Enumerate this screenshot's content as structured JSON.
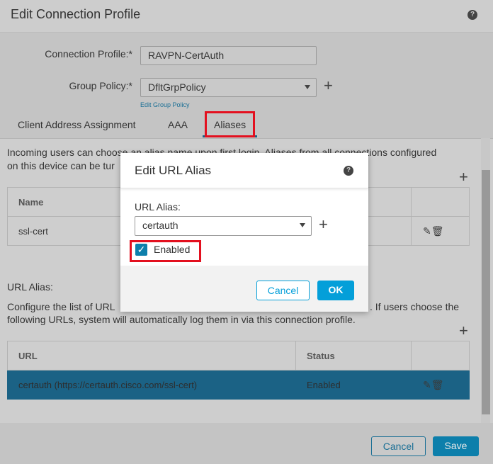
{
  "header": {
    "title": "Edit Connection Profile",
    "help_icon": "question-circle-icon"
  },
  "form": {
    "connection_profile": {
      "label": "Connection Profile:*",
      "value": "RAVPN-CertAuth"
    },
    "group_policy": {
      "label": "Group Policy:*",
      "value": "DfltGrpPolicy",
      "edit_link": "Edit Group Policy"
    }
  },
  "tabs": [
    {
      "label": "Client Address Assignment"
    },
    {
      "label": "AAA"
    },
    {
      "label": "Aliases",
      "active": true
    }
  ],
  "aliases": {
    "intro_line1": "Incoming users can choose an alias name upon first login. Aliases from all connections configured",
    "intro_line2": "on this device can be tur",
    "table": {
      "headers": [
        "Name"
      ],
      "rows": [
        {
          "name": "ssl-cert"
        }
      ]
    }
  },
  "url_alias": {
    "heading": "URL Alias:",
    "desc_line1_start": "Configure the list of URL",
    "desc_line1_end": ". If users choose the",
    "desc_line2": "following URLs, system will automatically log them in via this connection profile.",
    "table": {
      "headers": [
        "URL",
        "Status"
      ],
      "rows": [
        {
          "url": "certauth (https://certauth.cisco.com/ssl-cert)",
          "status": "Enabled",
          "selected": true
        }
      ]
    }
  },
  "footer": {
    "cancel": "Cancel",
    "save": "Save"
  },
  "modal": {
    "title": "Edit URL Alias",
    "field_label": "URL Alias:",
    "field_value": "certauth",
    "enabled_label": "Enabled",
    "enabled": true,
    "cancel": "Cancel",
    "ok": "OK"
  },
  "colors": {
    "accent": "#049fd9",
    "selected_row": "#1b6285",
    "highlight_box": "#e3101f"
  }
}
